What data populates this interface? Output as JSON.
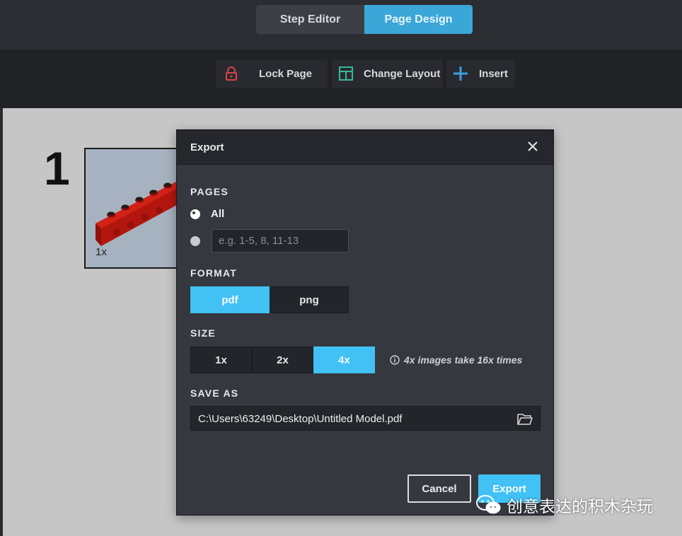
{
  "mode_toggle": {
    "step_editor": "Step Editor",
    "page_design": "Page Design"
  },
  "toolbar": {
    "lock_page": "Lock Page",
    "change_layout": "Change Layout",
    "insert": "Insert"
  },
  "canvas": {
    "step_number": "1",
    "part_quantity": "1x"
  },
  "dialog": {
    "title": "Export",
    "pages": {
      "heading": "PAGES",
      "all_label": "All",
      "range_placeholder": "e.g. 1-5, 8, 11-13",
      "selected": "All"
    },
    "format": {
      "heading": "FORMAT",
      "options": [
        "pdf",
        "png"
      ],
      "selected": "pdf"
    },
    "size": {
      "heading": "SIZE",
      "options": [
        "1x",
        "2x",
        "4x"
      ],
      "selected": "4x",
      "hint": "4x images take 16x times"
    },
    "save_as": {
      "heading": "SAVE AS",
      "path": "C:\\Users\\63249\\Desktop\\Untitled Model.pdf"
    },
    "cancel_label": "Cancel",
    "export_label": "Export"
  },
  "watermark": {
    "text": "创意表达的积木杂玩"
  },
  "colors": {
    "accent": "#42c1f5",
    "mode_active": "#3aa7d8",
    "lock_icon": "#d9434c",
    "layout_icon": "#3bb89a",
    "insert_icon": "#3aa0e0",
    "brick": "#c41a12"
  },
  "icons": {
    "lock": "lock-icon",
    "layout": "layout-icon",
    "insert": "plus-icon",
    "close": "close-icon",
    "info": "info-icon",
    "folder": "folder-icon"
  }
}
